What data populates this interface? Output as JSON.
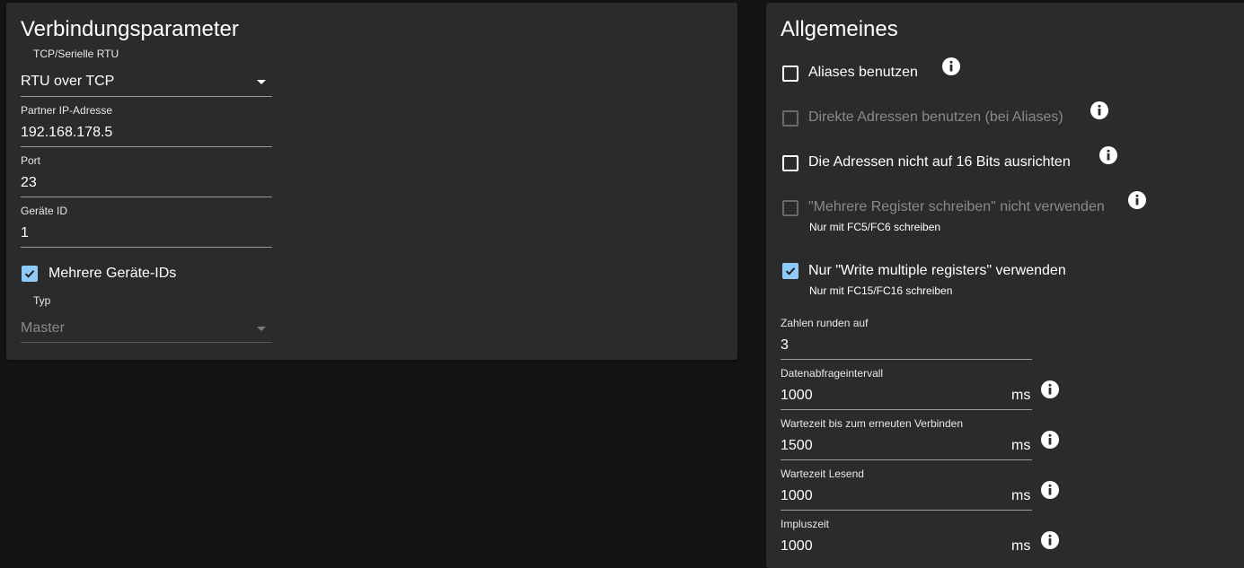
{
  "connection": {
    "title": "Verbindungsparameter",
    "type_label": "TCP/Serielle RTU",
    "type_value": "RTU over TCP",
    "ip_label": "Partner IP-Adresse",
    "ip_value": "192.168.178.5",
    "port_label": "Port",
    "port_value": "23",
    "device_id_label": "Geräte ID",
    "device_id_value": "1",
    "multi_ids_label": "Mehrere Geräte-IDs",
    "multi_ids_checked": true,
    "role_label": "Typ",
    "role_value": "Master"
  },
  "general": {
    "title": "Allgemeines",
    "options": [
      {
        "label": "Aliases benutzen",
        "checked": false,
        "disabled": false,
        "helper": ""
      },
      {
        "label": "Direkte Adressen benutzen (bei Aliases)",
        "checked": false,
        "disabled": true,
        "helper": ""
      },
      {
        "label": "Die Adressen nicht auf 16 Bits ausrichten",
        "checked": false,
        "disabled": false,
        "helper": ""
      },
      {
        "label": "\"Mehrere Register schreiben\" nicht verwenden",
        "checked": false,
        "disabled": true,
        "helper": "Nur mit FC5/FC6 schreiben"
      },
      {
        "label": "Nur \"Write multiple registers\" verwenden",
        "checked": true,
        "disabled": false,
        "helper": "Nur mit FC15/FC16 schreiben"
      }
    ],
    "round_label": "Zahlen runden auf",
    "round_value": "3",
    "poll_label": "Datenabfrageintervall",
    "poll_value": "1000",
    "poll_unit": "ms",
    "reconnect_label": "Wartezeit bis zum erneuten Verbinden",
    "reconnect_value": "1500",
    "reconnect_unit": "ms",
    "read_wait_label": "Wartezeit Lesend",
    "read_wait_value": "1000",
    "read_wait_unit": "ms",
    "pulse_label": "Impluszeit",
    "pulse_value": "1000",
    "pulse_unit": "ms"
  },
  "colors": {
    "accent": "#90caf9",
    "panel": "#2b2b2b",
    "background": "#141414"
  }
}
